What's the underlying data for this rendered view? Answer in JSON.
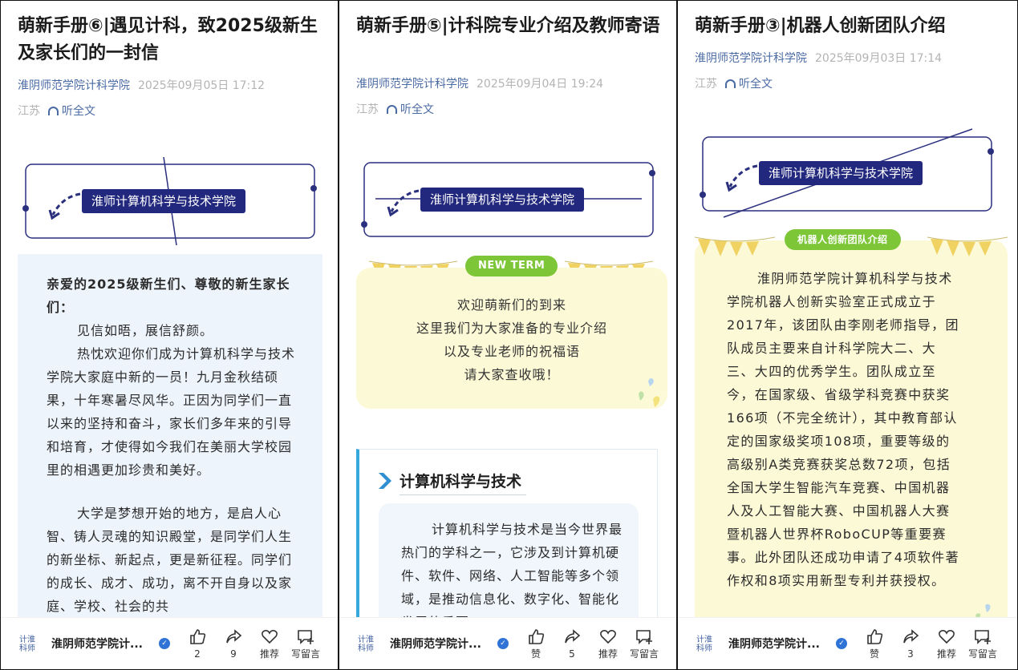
{
  "panels": [
    {
      "title": "萌新手册⑥|遇见计科，致2025级新生及家长们的一封信",
      "account": "淮阴师范学院计科学院",
      "date": "2025年09月05日 17:12",
      "location": "江苏",
      "listen_label": "听全文",
      "banner_label": "淮师计算机科学与技术学院",
      "greeting": "亲爱的2025级新生们、尊敬的新生家长们：",
      "paragraphs": [
        "见信如晤，展信舒颜。",
        "热忱欢迎你们成为计算机科学与技术学院大家庭中新的一员！九月金秋结硕果，十年寒暑尽风华。正因为同学们一直以来的坚持和奋斗，家长们多年来的引导和培育，才使得如今我们在美丽大学校园里的相遇更加珍贵和美好。",
        "大学是梦想开始的地方，是启人心智、铸人灵魂的知识殿堂，是同学们人生的新坐标、新起点，更是新征程。同学们的成长、成才、成功，离不开自身以及家庭、学校、社会的共"
      ],
      "footer": {
        "account_short": "淮阴师范学院计...",
        "logo_text": "计淮科师",
        "like_label": "2",
        "share_label": "9",
        "recommend_label": "推荐",
        "comment_label": "写留言"
      }
    },
    {
      "title": "萌新手册⑤|计科院专业介绍及教师寄语",
      "account": "淮阴师范学院计科学院",
      "date": "2025年09月04日 19:24",
      "location": "江苏",
      "listen_label": "听全文",
      "banner_label": "淮师计算机科学与技术学院",
      "badge": "NEW TERM",
      "welcome_lines": [
        "欢迎萌新们的到来",
        "这里我们为大家准备的专业介绍",
        "以及专业老师的祝福语",
        "请大家查收哦！"
      ],
      "section_title": "计算机科学与技术",
      "section_text": "计算机科学与技术是当今世界最热门的学科之一，它涉及到计算机硬件、软件、网络、人工智能等多个领域，是推动信息化、数字化、智能化发展的重要",
      "footer": {
        "account_short": "淮阴师范学院计...",
        "logo_text": "计淮科师",
        "like_label": "赞",
        "share_label": "5",
        "recommend_label": "推荐",
        "comment_label": "写留言"
      }
    },
    {
      "title": "萌新手册③|机器人创新团队介绍",
      "account": "淮阴师范学院计科学院",
      "date": "2025年09月03日 17:14",
      "location": "江苏",
      "listen_label": "听全文",
      "banner_label": "淮师计算机科学与技术学院",
      "badge": "机器人创新团队介绍",
      "body": "淮阴师范学院计算机科学与技术学院机器人创新实验室正式成立于2017年，该团队由李刚老师指导，团队成员主要来自计科学院大二、大三、大四的优秀学生。团队成立至今，在国家级、省级学科竞赛中获奖166项（不完全统计），其中教育部认定的国家级奖项108项，重要等级的高级别A类竞赛获奖总数72项，包括全国大学生智能汽车竞赛、中国机器人及人工智能大赛、中国机器人大赛暨机器人世界杯RoboCUP等重要赛事。此外团队还成功申请了4项软件著作权和8项实用新型专利并获授权。",
      "footer": {
        "account_short": "淮阴师范学院计...",
        "logo_text": "计淮科师",
        "like_label": "赞",
        "share_label": "3",
        "recommend_label": "推荐",
        "comment_label": "写留言"
      }
    }
  ],
  "colors": {
    "accent_link": "#4a6aa3",
    "banner_navy": "#22287d",
    "leaf_green": "#7cc638",
    "card_yellow": "#fcf9d6",
    "card_blue": "#eef4fc",
    "verify_blue": "#2f73d6"
  },
  "icons": [
    "headphone-icon",
    "thumbs-up-icon",
    "share-arrow-icon",
    "heart-icon",
    "comment-icon",
    "verified-icon",
    "chevron-right-icon"
  ]
}
